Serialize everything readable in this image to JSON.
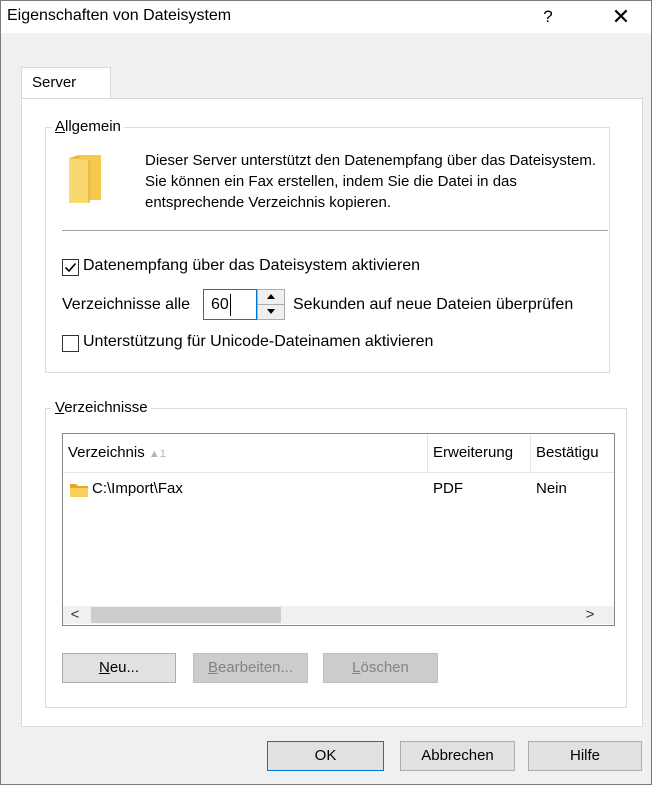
{
  "window": {
    "title": "Eigenschaften von Dateisystem",
    "help_glyph": "?",
    "close_glyph": "✕"
  },
  "tabs": [
    {
      "label": "Server"
    }
  ],
  "general": {
    "legend_mnemonic": "A",
    "legend_rest": "llgemein",
    "folder_icon": "folder-icon",
    "info_text": "Dieser Server unterstützt den Datenempfang über das Dateisystem. Sie können ein Fax erstellen, indem Sie die Datei in das entsprechende Verzeichnis kopieren.",
    "enable_checkbox": {
      "label": "Datenempfang über das Dateisystem aktivieren",
      "checked": true
    },
    "interval_prefix": "Verzeichnisse alle",
    "interval_value": "60",
    "interval_suffix": "Sekunden auf neue Dateien überprüfen",
    "unicode_checkbox": {
      "label": "Unterstützung für Unicode-Dateinamen aktivieren",
      "checked": false
    }
  },
  "directories": {
    "legend_mnemonic": "V",
    "legend_rest": "erzeichnisse",
    "columns": [
      {
        "label": "Verzeichnis",
        "sort_hint": "▲1"
      },
      {
        "label": "Erweiterung"
      },
      {
        "label": "Bestätigu"
      }
    ],
    "rows": [
      {
        "path": "C:\\Import\\Fax",
        "extension": "PDF",
        "confirmation": "Nein"
      }
    ],
    "scroll_left_glyph": "<",
    "scroll_right_glyph": ">",
    "new_button": {
      "mnemonic": "N",
      "rest": "eu..."
    },
    "edit_button": {
      "mnemonic": "B",
      "rest": "earbeiten..."
    },
    "delete_button": {
      "mnemonic": "L",
      "rest": "öschen"
    }
  },
  "footer": {
    "ok_label": "OK",
    "cancel_label": "Abbrechen",
    "help_label": "Hilfe"
  },
  "colors": {
    "accent": "#0078d7",
    "folder_yellow": "#f5c94c"
  }
}
